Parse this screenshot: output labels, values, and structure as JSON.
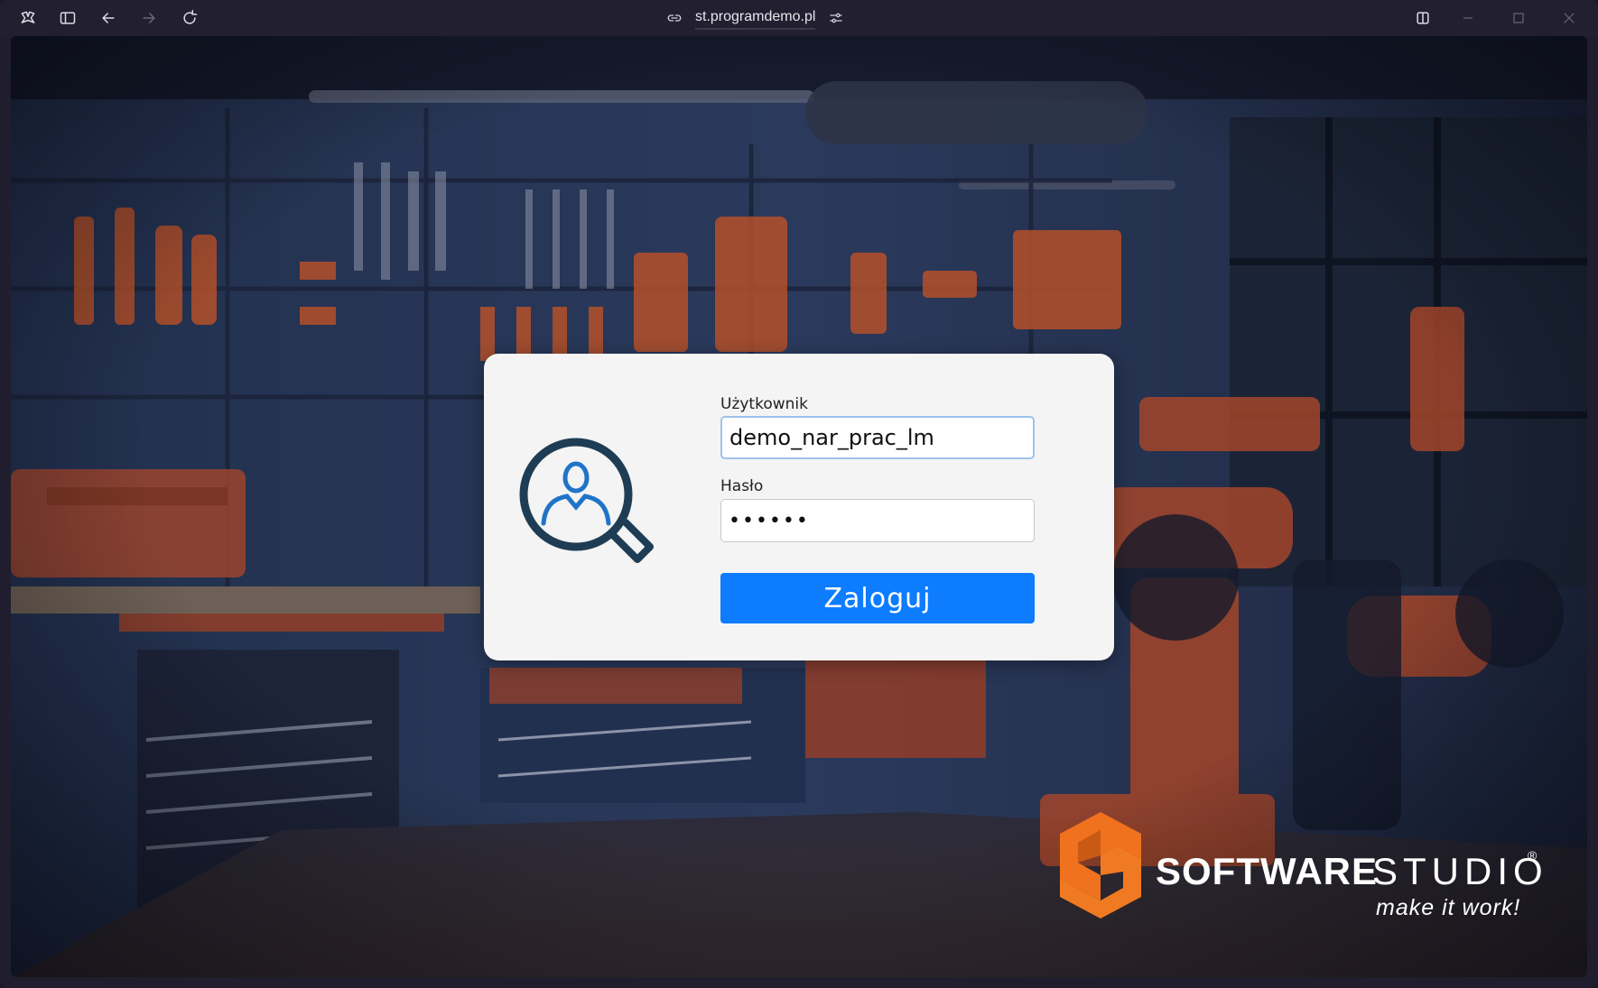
{
  "browser": {
    "url": "st.programdemo.pl",
    "icons": [
      "app-logo-icon",
      "sidebar-toggle-icon",
      "back-icon",
      "forward-icon",
      "reload-icon",
      "link-icon",
      "site-settings-icon",
      "split-view-icon",
      "minimize-icon",
      "maximize-icon",
      "close-icon"
    ]
  },
  "login": {
    "username_label": "Użytkownik",
    "username_value": "demo_nar_prac_lm",
    "password_label": "Hasło",
    "password_value": "••••••",
    "submit_label": "Zaloguj"
  },
  "brand": {
    "software": "SOFTWARE",
    "studio": "STUDIO",
    "reg": "®",
    "tagline": "make it work!"
  },
  "colors": {
    "accent": "#0d7cff",
    "card_bg": "#f4f4f4",
    "logo_orange": "#f0721e",
    "icon_navy": "#1e3d55",
    "icon_blue": "#1f74c8"
  }
}
